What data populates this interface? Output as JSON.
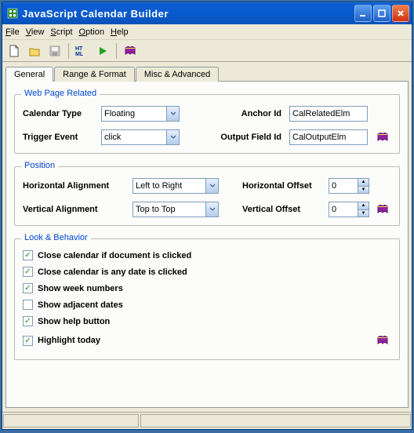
{
  "title": "JavaScript Calendar Builder",
  "menu": {
    "file": "File",
    "view": "View",
    "script": "Script",
    "option": "Option",
    "help": "Help"
  },
  "tabs": {
    "general": "General",
    "range": "Range & Format",
    "misc": "Misc & Advanced"
  },
  "web_page_related": {
    "legend": "Web Page Related",
    "calendar_type_label": "Calendar Type",
    "calendar_type_value": "Floating",
    "trigger_event_label": "Trigger Event",
    "trigger_event_value": "click",
    "anchor_id_label": "Anchor Id",
    "anchor_id_value": "CalRelatedElm",
    "output_field_id_label": "Output Field Id",
    "output_field_id_value": "CalOutputElm"
  },
  "position": {
    "legend": "Position",
    "h_align_label": "Horizontal Alignment",
    "h_align_value": "Left to Right",
    "v_align_label": "Vertical Alignment",
    "v_align_value": "Top to Top",
    "h_offset_label": "Horizontal Offset",
    "h_offset_value": "0",
    "v_offset_label": "Vertical Offset",
    "v_offset_value": "0"
  },
  "look_behavior": {
    "legend": "Look & Behavior",
    "close_doc": {
      "checked": true,
      "label": "Close calendar if document is clicked"
    },
    "close_date": {
      "checked": true,
      "label": "Close calendar is any date is clicked"
    },
    "week_nums": {
      "checked": true,
      "label": "Show week numbers"
    },
    "adjacent": {
      "checked": false,
      "label": "Show adjacent dates"
    },
    "help_btn": {
      "checked": true,
      "label": "Show help button"
    },
    "highlight": {
      "checked": true,
      "label": "Highlight today"
    }
  }
}
